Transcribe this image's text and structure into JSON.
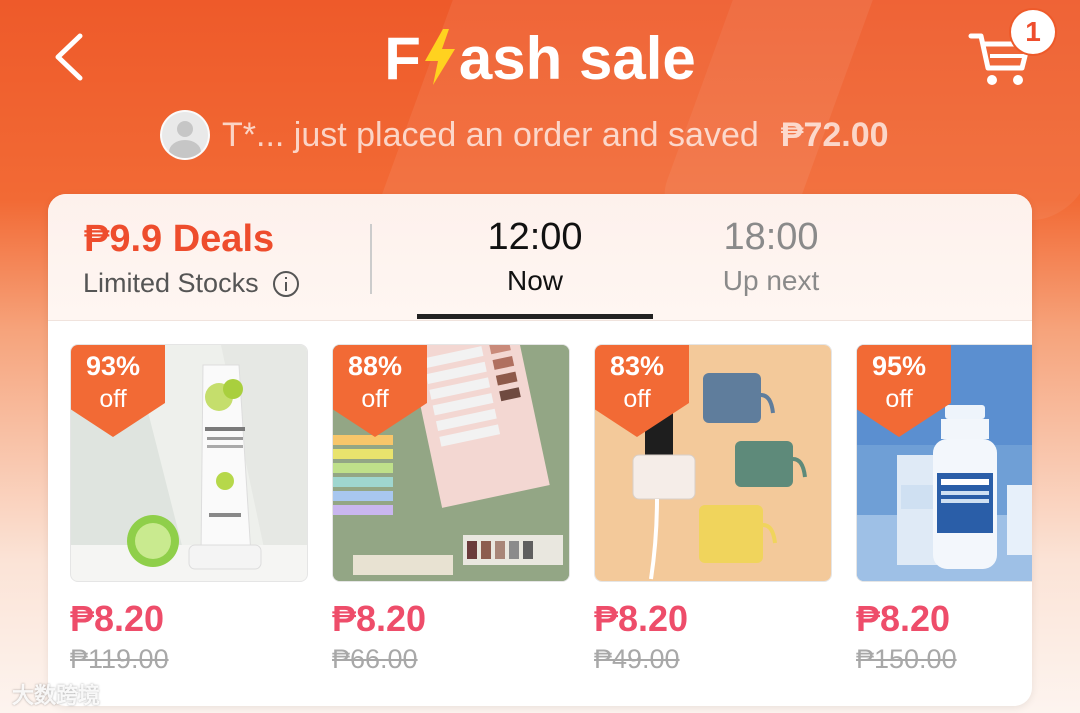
{
  "header": {
    "title_prefix": "F",
    "title_suffix": "ash sale",
    "cart_count": "1"
  },
  "notice": {
    "text": "T*... just placed an order and saved",
    "amount": "₱72.00"
  },
  "tabs": {
    "deals_title": "₱9.9 Deals",
    "deals_subtitle": "Limited Stocks",
    "slots": [
      {
        "time": "12:00",
        "label": "Now"
      },
      {
        "time": "18:00",
        "label": "Up next"
      }
    ]
  },
  "products": [
    {
      "discount": "93%",
      "off": "off",
      "price": "₱8.20",
      "original": "₱119.00"
    },
    {
      "discount": "88%",
      "off": "off",
      "price": "₱8.20",
      "original": "₱66.00"
    },
    {
      "discount": "83%",
      "off": "off",
      "price": "₱8.20",
      "original": "₱49.00"
    },
    {
      "discount": "95%",
      "off": "off",
      "price": "₱8.20",
      "original": "₱150.00"
    }
  ],
  "watermark": "大数跨境",
  "colors": {
    "brand": "#ee4d2d",
    "price": "#ee4d6a",
    "badge": "#f26a35"
  }
}
